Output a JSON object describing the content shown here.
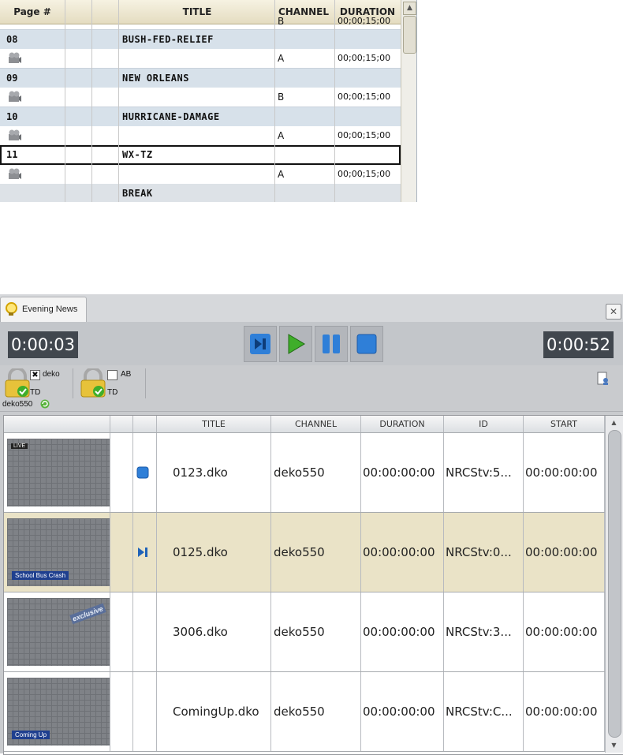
{
  "top_table": {
    "headers": [
      "Page #",
      "TITLE",
      "CHANNEL",
      "DURATION"
    ],
    "partial_top_row": {
      "channel": "B",
      "duration": "00;00;15;00"
    },
    "rows": [
      {
        "kind": "segment",
        "page": "08",
        "title": "BUSH-FED-RELIEF"
      },
      {
        "kind": "clip",
        "icon": "film-reel-icon",
        "channel": "A",
        "duration": "00;00;15;00"
      },
      {
        "kind": "segment",
        "page": "09",
        "title": "NEW ORLEANS"
      },
      {
        "kind": "clip",
        "icon": "film-reel-icon",
        "channel": "B",
        "duration": "00;00;15;00"
      },
      {
        "kind": "segment",
        "page": "10",
        "title": "HURRICANE-DAMAGE"
      },
      {
        "kind": "clip",
        "icon": "film-reel-icon",
        "channel": "A",
        "duration": "00;00;15;00"
      },
      {
        "kind": "selected",
        "page": "11",
        "title": "WX-TZ"
      },
      {
        "kind": "clip",
        "icon": "film-reel-icon",
        "channel": "A",
        "duration": "00;00;15;00"
      },
      {
        "kind": "break",
        "title": "BREAK"
      }
    ]
  },
  "panel": {
    "tab_title": "Evening News",
    "elapsed": "0:00:03",
    "remaining": "0:00:52",
    "transport": [
      "skip-next-icon",
      "play-icon",
      "pause-icon",
      "stop-icon"
    ],
    "channels": [
      {
        "name": "deko",
        "checked": true,
        "mark": "✖",
        "user": "TD"
      },
      {
        "name": "AB",
        "checked": false,
        "mark": "",
        "user": "TD"
      }
    ],
    "device": "deko550",
    "grid": {
      "headers": [
        "TITLE",
        "CHANNEL",
        "DURATION",
        "ID",
        "START"
      ],
      "rows": [
        {
          "status": "stop-icon",
          "title": "0123.dko",
          "channel": "deko550",
          "duration": "00:00:00:00",
          "id": "NRCStv:5...",
          "start": "00:00:00:00",
          "highlight": false,
          "thumb_text": "LIVE"
        },
        {
          "status": "skip-next-icon",
          "title": "0125.dko",
          "channel": "deko550",
          "duration": "00:00:00:00",
          "id": "NRCStv:0...",
          "start": "00:00:00:00",
          "highlight": true,
          "thumb_text": "School Bus Crash"
        },
        {
          "status": "",
          "title": "3006.dko",
          "channel": "deko550",
          "duration": "00:00:00:00",
          "id": "NRCStv:3...",
          "start": "00:00:00:00",
          "highlight": false,
          "thumb_text": "exclusive"
        },
        {
          "status": "",
          "title": "ComingUp.dko",
          "channel": "deko550",
          "duration": "00:00:00:00",
          "id": "NRCStv:C...",
          "start": "00:00:00:00",
          "highlight": false,
          "thumb_text": "Coming Up"
        }
      ]
    },
    "colors": {
      "timer_bg": "#41474e",
      "transport_blue": "#2f7fd8",
      "play_green": "#3fae2a",
      "highlight_row": "#eae3c7"
    }
  }
}
